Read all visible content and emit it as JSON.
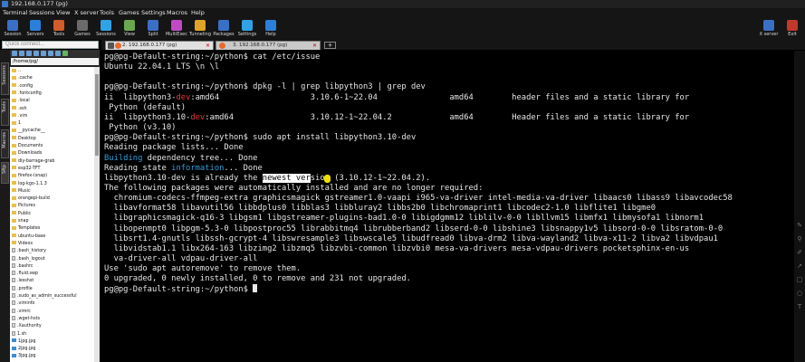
{
  "window": {
    "title": "192.168.0.177 (pg)"
  },
  "menu": [
    "Terminal",
    "Sessions",
    "View",
    "X server",
    "Tools",
    "Games",
    "Settings",
    "Macros",
    "Help"
  ],
  "toolbar": {
    "buttons": [
      {
        "label": "Session",
        "icon": "session-icon",
        "color": "#3b6fc6"
      },
      {
        "label": "Servers",
        "icon": "servers-icon",
        "color": "#2c7fd8"
      },
      {
        "label": "Tools",
        "icon": "tools-icon",
        "color": "#d45b2a"
      },
      {
        "label": "Games",
        "icon": "games-icon",
        "color": "#6a6a6a"
      },
      {
        "label": "Sessions",
        "icon": "sessions-icon",
        "color": "#2fa3e6"
      },
      {
        "label": "View",
        "icon": "view-icon",
        "color": "#6aa84f"
      },
      {
        "label": "Split",
        "icon": "split-icon",
        "color": "#3b6fc6"
      },
      {
        "label": "MultiExec",
        "icon": "multiexec-icon",
        "color": "#c14ac4"
      },
      {
        "label": "Tunneling",
        "icon": "tunneling-icon",
        "color": "#e0a32a"
      },
      {
        "label": "Packages",
        "icon": "packages-icon",
        "color": "#3b6fc6"
      },
      {
        "label": "Settings",
        "icon": "settings-icon",
        "color": "#2fa3e6"
      },
      {
        "label": "Help",
        "icon": "help-icon",
        "color": "#2c7fd8"
      }
    ],
    "xserver": {
      "label": "X server",
      "icon": "xserver-icon",
      "color": "#3b6fc6"
    },
    "exit": {
      "label": "Exit",
      "icon": "exit-icon",
      "color": "#c0392b"
    }
  },
  "quick_connect": {
    "placeholder": "Quick connect..."
  },
  "tabs": [
    {
      "label": "2. 192.168.0.177 (pg)",
      "active": true
    },
    {
      "label": "3. 192.168.0.177 (pg)",
      "active": false
    }
  ],
  "new_tab_label": "+",
  "side_tabs": [
    "Sessions",
    "Tools",
    "Macros",
    "Sftp"
  ],
  "sftp": {
    "path": "/home/pg/",
    "files": [
      {
        "name": "..",
        "kind": "folder"
      },
      {
        "name": ".cache",
        "kind": "folder"
      },
      {
        "name": ".config",
        "kind": "folder"
      },
      {
        "name": ".fontconfig",
        "kind": "folder"
      },
      {
        "name": ".local",
        "kind": "folder"
      },
      {
        "name": ".ssh",
        "kind": "folder"
      },
      {
        "name": ".vim",
        "kind": "folder"
      },
      {
        "name": "1",
        "kind": "folder"
      },
      {
        "name": "__pycache__",
        "kind": "folder"
      },
      {
        "name": "Desktop",
        "kind": "folder"
      },
      {
        "name": "Documents",
        "kind": "folder"
      },
      {
        "name": "Downloads",
        "kind": "folder"
      },
      {
        "name": "diy-barrage-grab",
        "kind": "folder"
      },
      {
        "name": "esp32-TFT",
        "kind": "folder"
      },
      {
        "name": "firefox-(snap)",
        "kind": "folder"
      },
      {
        "name": "log-kgo-1.1.3",
        "kind": "folder"
      },
      {
        "name": "Music",
        "kind": "folder"
      },
      {
        "name": "orangepi-build",
        "kind": "folder"
      },
      {
        "name": "Pictures",
        "kind": "folder"
      },
      {
        "name": "Public",
        "kind": "folder"
      },
      {
        "name": "snap",
        "kind": "folder"
      },
      {
        "name": "Templates",
        "kind": "folder"
      },
      {
        "name": "ubuntu-base",
        "kind": "folder"
      },
      {
        "name": "Videos",
        "kind": "folder"
      },
      {
        "name": ".bash_history",
        "kind": "file"
      },
      {
        "name": ".bash_logout",
        "kind": "file"
      },
      {
        "name": ".bashrc",
        "kind": "file"
      },
      {
        "name": ".fluid.swp",
        "kind": "file"
      },
      {
        "name": ".lesshst",
        "kind": "file"
      },
      {
        "name": ".profile",
        "kind": "file"
      },
      {
        "name": ".sudo_as_admin_successful",
        "kind": "file"
      },
      {
        "name": ".viminfo",
        "kind": "file"
      },
      {
        "name": ".vimrc",
        "kind": "file"
      },
      {
        "name": ".wget-hsts",
        "kind": "file"
      },
      {
        "name": ".Xauthority",
        "kind": "file"
      },
      {
        "name": "1.sh",
        "kind": "file"
      },
      {
        "name": "1jpg.jpg",
        "kind": "img"
      },
      {
        "name": "2jpg.jpg",
        "kind": "img"
      },
      {
        "name": "3jpg.jpg",
        "kind": "img"
      }
    ]
  },
  "terminal": {
    "lines": [
      [
        {
          "t": "pg@pg-Default-string:~/python$ cat /etc/issue"
        }
      ],
      [
        {
          "t": "Ubuntu 22.04.1 LTS \\n \\l"
        }
      ],
      [
        {
          "t": ""
        }
      ],
      [
        {
          "t": "pg@pg-Default-string:~/python$ dpkg -l | grep libpython3 | grep dev"
        }
      ],
      [
        {
          "t": "ii  libpython3-"
        },
        {
          "t": "dev",
          "c": "red"
        },
        {
          "t": ":amd64                   3.10.6-1~22.04               amd64        header files and a static library for"
        }
      ],
      [
        {
          "t": " Python (default)"
        }
      ],
      [
        {
          "t": "ii  libpython3.10-"
        },
        {
          "t": "dev",
          "c": "red"
        },
        {
          "t": ":amd64                3.10.12-1~22.04.2            amd64        Header files and a static library for"
        }
      ],
      [
        {
          "t": " Python (v3.10)"
        }
      ],
      [
        {
          "t": "pg@pg-Default-string:~/python$ sudo apt install libpython3.10-dev"
        }
      ],
      [
        {
          "t": "Reading package lists... Done"
        }
      ],
      [
        {
          "t": "Building",
          "c": "blu"
        },
        {
          "t": " dependency tree... Done"
        }
      ],
      [
        {
          "t": "Reading state "
        },
        {
          "t": "information",
          "c": "blu"
        },
        {
          "t": "... Done"
        }
      ],
      [
        {
          "t": "libpython3.10-dev is already the "
        },
        {
          "t": "newest ver",
          "c": "hl"
        },
        {
          "t": "sion (3.10.12-1~22.04.2)."
        }
      ],
      [
        {
          "t": "The following packages were automatically installed and are no longer required:"
        }
      ],
      [
        {
          "t": "  chromium-codecs-ffmpeg-extra graphicsmagick gstreamer1.0-vaapi i965-va-driver intel-media-va-driver libaacs0 libass9 libavcodec58"
        }
      ],
      [
        {
          "t": "  libavformat58 libavutil56 libbdplus0 libblas3 libbluray2 libbs2b0 libchromaprint1 libcodec2-1.0 libflite1 libgme0"
        }
      ],
      [
        {
          "t": "  libgraphicsmagick-q16-3 libgsm1 libgstreamer-plugins-bad1.0-0 libigdgmm12 liblilv-0-0 libllvm15 libmfx1 libmysofa1 libnorm1"
        }
      ],
      [
        {
          "t": "  libopenmpt0 libpgm-5.3-0 libpostproc55 librabbitmq4 librubberband2 libserd-0-0 libshine3 libsnappy1v5 libsord-0-0 libsratom-0-0"
        }
      ],
      [
        {
          "t": "  libsrt1.4-gnutls libssh-gcrypt-4 libswresample3 libswscale5 libudfread0 libva-drm2 libva-wayland2 libva-x11-2 libva2 libvdpau1"
        }
      ],
      [
        {
          "t": "  libvidstab1.1 libx264-163 libzimg2 libzmq5 libzvbi-common libzvbi0 mesa-va-drivers mesa-vdpau-drivers pocketsphinx-en-us"
        }
      ],
      [
        {
          "t": "  va-driver-all vdpau-driver-all"
        }
      ],
      [
        {
          "t": "Use 'sudo apt autoremove' to remove them."
        }
      ],
      [
        {
          "t": "0 upgraded, 0 newly installed, 0 to remove and 231 not upgraded."
        }
      ],
      [
        {
          "t": "pg@pg-Default-string:~/python$ "
        },
        {
          "cursor": true
        }
      ]
    ]
  }
}
